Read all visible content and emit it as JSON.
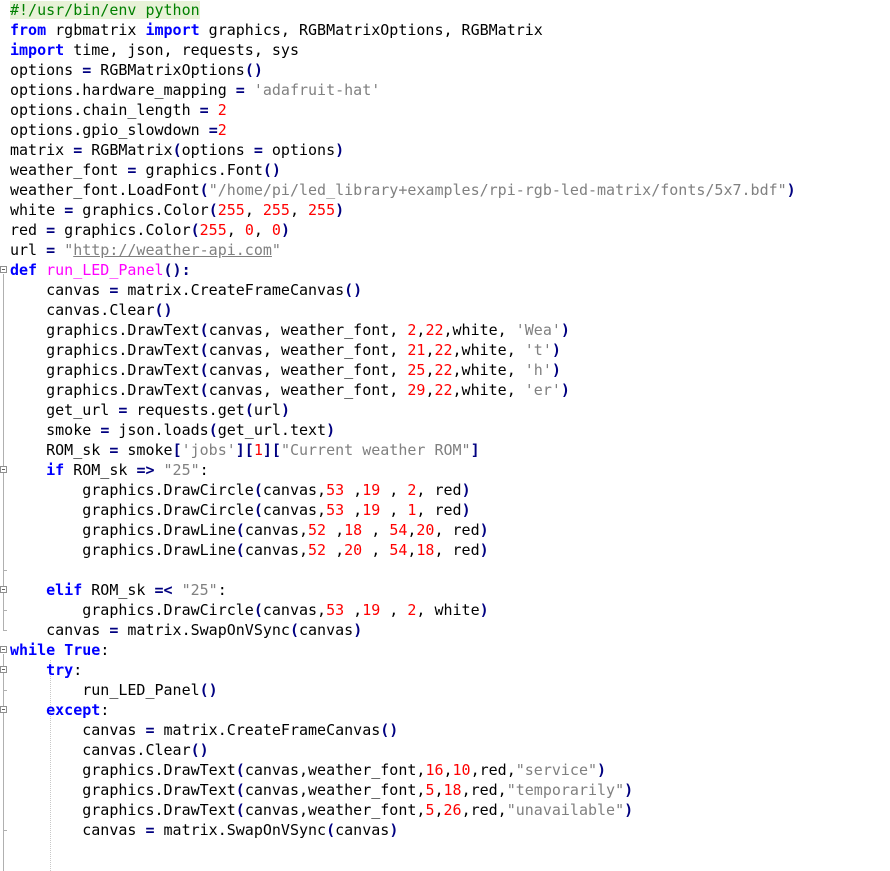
{
  "colors": {
    "default": "#000000",
    "keyword": "#0000ff",
    "string": "#808080",
    "number": "#ff0000",
    "operator": "#000080",
    "comment": "#008000",
    "funcdef": "#ff00ff",
    "url": "#808080"
  },
  "lines": [
    [
      [
        "comment",
        "#!/usr/bin/env python"
      ]
    ],
    [
      [
        "keyword",
        "from"
      ],
      [
        "default",
        " rgbmatrix "
      ],
      [
        "keyword",
        "import"
      ],
      [
        "default",
        " graphics, RGBMatrixOptions, RGBMatrix"
      ]
    ],
    [
      [
        "keyword",
        "import"
      ],
      [
        "default",
        " time, json, requests, sys"
      ]
    ],
    [
      [
        "default",
        "options "
      ],
      [
        "operator",
        "="
      ],
      [
        "default",
        " RGBMatrixOptions"
      ],
      [
        "operator",
        "()"
      ]
    ],
    [
      [
        "default",
        "options.hardware_mapping "
      ],
      [
        "operator",
        "="
      ],
      [
        "default",
        " "
      ],
      [
        "string",
        "'adafruit-hat'"
      ]
    ],
    [
      [
        "default",
        "options.chain_length "
      ],
      [
        "operator",
        "="
      ],
      [
        "default",
        " "
      ],
      [
        "number",
        "2"
      ]
    ],
    [
      [
        "default",
        "options.gpio_slowdown "
      ],
      [
        "operator",
        "="
      ],
      [
        "number",
        "2"
      ]
    ],
    [
      [
        "default",
        "matrix "
      ],
      [
        "operator",
        "="
      ],
      [
        "default",
        " RGBMatrix"
      ],
      [
        "operator",
        "("
      ],
      [
        "default",
        "options "
      ],
      [
        "operator",
        "="
      ],
      [
        "default",
        " options"
      ],
      [
        "operator",
        ")"
      ]
    ],
    [
      [
        "default",
        "weather_font "
      ],
      [
        "operator",
        "="
      ],
      [
        "default",
        " graphics.Font"
      ],
      [
        "operator",
        "()"
      ]
    ],
    [
      [
        "default",
        "weather_font.LoadFont"
      ],
      [
        "operator",
        "("
      ],
      [
        "string",
        "\"/home/pi/led_library+examples/rpi-rgb-led-matrix/fonts/5x7.bdf\""
      ],
      [
        "operator",
        ")"
      ]
    ],
    [
      [
        "default",
        "white "
      ],
      [
        "operator",
        "="
      ],
      [
        "default",
        " graphics.Color"
      ],
      [
        "operator",
        "("
      ],
      [
        "number",
        "255"
      ],
      [
        "default",
        ", "
      ],
      [
        "number",
        "255"
      ],
      [
        "default",
        ", "
      ],
      [
        "number",
        "255"
      ],
      [
        "operator",
        ")"
      ]
    ],
    [
      [
        "default",
        "red "
      ],
      [
        "operator",
        "="
      ],
      [
        "default",
        " graphics.Color"
      ],
      [
        "operator",
        "("
      ],
      [
        "number",
        "255"
      ],
      [
        "default",
        ", "
      ],
      [
        "number",
        "0"
      ],
      [
        "default",
        ", "
      ],
      [
        "number",
        "0"
      ],
      [
        "operator",
        ")"
      ]
    ],
    [
      [
        "default",
        "url "
      ],
      [
        "operator",
        "="
      ],
      [
        "default",
        " "
      ],
      [
        "string",
        "\""
      ],
      [
        "url",
        "http://weather-api.com"
      ],
      [
        "string",
        "\""
      ]
    ],
    [
      [
        "keyword",
        "def"
      ],
      [
        "default",
        " "
      ],
      [
        "funcdef",
        "run_LED_Panel"
      ],
      [
        "operator",
        "():"
      ]
    ],
    [
      [
        "default",
        "    canvas "
      ],
      [
        "operator",
        "="
      ],
      [
        "default",
        " matrix.CreateFrameCanvas"
      ],
      [
        "operator",
        "()"
      ]
    ],
    [
      [
        "default",
        "    canvas.Clear"
      ],
      [
        "operator",
        "()"
      ]
    ],
    [
      [
        "default",
        "    graphics.DrawText"
      ],
      [
        "operator",
        "("
      ],
      [
        "default",
        "canvas, weather_font, "
      ],
      [
        "number",
        "2"
      ],
      [
        "default",
        ","
      ],
      [
        "number",
        "22"
      ],
      [
        "default",
        ",white, "
      ],
      [
        "string",
        "'Wea'"
      ],
      [
        "operator",
        ")"
      ]
    ],
    [
      [
        "default",
        "    graphics.DrawText"
      ],
      [
        "operator",
        "("
      ],
      [
        "default",
        "canvas, weather_font, "
      ],
      [
        "number",
        "21"
      ],
      [
        "default",
        ","
      ],
      [
        "number",
        "22"
      ],
      [
        "default",
        ",white, "
      ],
      [
        "string",
        "'t'"
      ],
      [
        "operator",
        ")"
      ]
    ],
    [
      [
        "default",
        "    graphics.DrawText"
      ],
      [
        "operator",
        "("
      ],
      [
        "default",
        "canvas, weather_font, "
      ],
      [
        "number",
        "25"
      ],
      [
        "default",
        ","
      ],
      [
        "number",
        "22"
      ],
      [
        "default",
        ",white, "
      ],
      [
        "string",
        "'h'"
      ],
      [
        "operator",
        ")"
      ]
    ],
    [
      [
        "default",
        "    graphics.DrawText"
      ],
      [
        "operator",
        "("
      ],
      [
        "default",
        "canvas, weather_font, "
      ],
      [
        "number",
        "29"
      ],
      [
        "default",
        ","
      ],
      [
        "number",
        "22"
      ],
      [
        "default",
        ",white, "
      ],
      [
        "string",
        "'er'"
      ],
      [
        "operator",
        ")"
      ]
    ],
    [
      [
        "default",
        "    get_url "
      ],
      [
        "operator",
        "="
      ],
      [
        "default",
        " requests.get"
      ],
      [
        "operator",
        "("
      ],
      [
        "default",
        "url"
      ],
      [
        "operator",
        ")"
      ]
    ],
    [
      [
        "default",
        "    smoke "
      ],
      [
        "operator",
        "="
      ],
      [
        "default",
        " json.loads"
      ],
      [
        "operator",
        "("
      ],
      [
        "default",
        "get_url.text"
      ],
      [
        "operator",
        ")"
      ]
    ],
    [
      [
        "default",
        "    ROM_sk "
      ],
      [
        "operator",
        "="
      ],
      [
        "default",
        " smoke"
      ],
      [
        "operator",
        "["
      ],
      [
        "string",
        "'jobs'"
      ],
      [
        "operator",
        "]["
      ],
      [
        "number",
        "1"
      ],
      [
        "operator",
        "]["
      ],
      [
        "string",
        "\"Current weather ROM\""
      ],
      [
        "operator",
        "]"
      ]
    ],
    [
      [
        "default",
        "    "
      ],
      [
        "keyword",
        "if"
      ],
      [
        "default",
        " ROM_sk "
      ],
      [
        "operator",
        "=>"
      ],
      [
        "default",
        " "
      ],
      [
        "string",
        "\"25\""
      ],
      [
        "default",
        ":"
      ]
    ],
    [
      [
        "default",
        "        graphics.DrawCircle"
      ],
      [
        "operator",
        "("
      ],
      [
        "default",
        "canvas,"
      ],
      [
        "number",
        "53"
      ],
      [
        "default",
        " ,"
      ],
      [
        "number",
        "19"
      ],
      [
        "default",
        " , "
      ],
      [
        "number",
        "2"
      ],
      [
        "default",
        ", red"
      ],
      [
        "operator",
        ")"
      ]
    ],
    [
      [
        "default",
        "        graphics.DrawCircle"
      ],
      [
        "operator",
        "("
      ],
      [
        "default",
        "canvas,"
      ],
      [
        "number",
        "53"
      ],
      [
        "default",
        " ,"
      ],
      [
        "number",
        "19"
      ],
      [
        "default",
        " , "
      ],
      [
        "number",
        "1"
      ],
      [
        "default",
        ", red"
      ],
      [
        "operator",
        ")"
      ]
    ],
    [
      [
        "default",
        "        graphics.DrawLine"
      ],
      [
        "operator",
        "("
      ],
      [
        "default",
        "canvas,"
      ],
      [
        "number",
        "52"
      ],
      [
        "default",
        " ,"
      ],
      [
        "number",
        "18"
      ],
      [
        "default",
        " , "
      ],
      [
        "number",
        "54"
      ],
      [
        "default",
        ","
      ],
      [
        "number",
        "20"
      ],
      [
        "default",
        ", red"
      ],
      [
        "operator",
        ")"
      ]
    ],
    [
      [
        "default",
        "        graphics.DrawLine"
      ],
      [
        "operator",
        "("
      ],
      [
        "default",
        "canvas,"
      ],
      [
        "number",
        "52"
      ],
      [
        "default",
        " ,"
      ],
      [
        "number",
        "20"
      ],
      [
        "default",
        " , "
      ],
      [
        "number",
        "54"
      ],
      [
        "default",
        ","
      ],
      [
        "number",
        "18"
      ],
      [
        "default",
        ", red"
      ],
      [
        "operator",
        ")"
      ]
    ],
    [
      [
        "default",
        ""
      ]
    ],
    [
      [
        "default",
        "    "
      ],
      [
        "keyword",
        "elif"
      ],
      [
        "default",
        " ROM_sk "
      ],
      [
        "operator",
        "=<"
      ],
      [
        "default",
        " "
      ],
      [
        "string",
        "\"25\""
      ],
      [
        "default",
        ":"
      ]
    ],
    [
      [
        "default",
        "        graphics.DrawCircle"
      ],
      [
        "operator",
        "("
      ],
      [
        "default",
        "canvas,"
      ],
      [
        "number",
        "53"
      ],
      [
        "default",
        " ,"
      ],
      [
        "number",
        "19"
      ],
      [
        "default",
        " , "
      ],
      [
        "number",
        "2"
      ],
      [
        "default",
        ", white"
      ],
      [
        "operator",
        ")"
      ]
    ],
    [
      [
        "default",
        "    canvas "
      ],
      [
        "operator",
        "="
      ],
      [
        "default",
        " matrix.SwapOnVSync"
      ],
      [
        "operator",
        "("
      ],
      [
        "default",
        "canvas"
      ],
      [
        "operator",
        ")"
      ]
    ],
    [
      [
        "keyword",
        "while"
      ],
      [
        "default",
        " "
      ],
      [
        "keyword",
        "True"
      ],
      [
        "default",
        ":"
      ]
    ],
    [
      [
        "default",
        "    "
      ],
      [
        "keyword",
        "try"
      ],
      [
        "default",
        ":"
      ]
    ],
    [
      [
        "default",
        "        run_LED_Panel"
      ],
      [
        "operator",
        "()"
      ]
    ],
    [
      [
        "default",
        "    "
      ],
      [
        "keyword",
        "except"
      ],
      [
        "default",
        ":"
      ]
    ],
    [
      [
        "default",
        "        canvas "
      ],
      [
        "operator",
        "="
      ],
      [
        "default",
        " matrix.CreateFrameCanvas"
      ],
      [
        "operator",
        "()"
      ]
    ],
    [
      [
        "default",
        "        canvas.Clear"
      ],
      [
        "operator",
        "()"
      ]
    ],
    [
      [
        "default",
        "        graphics.DrawText"
      ],
      [
        "operator",
        "("
      ],
      [
        "default",
        "canvas,weather_font,"
      ],
      [
        "number",
        "16"
      ],
      [
        "default",
        ","
      ],
      [
        "number",
        "10"
      ],
      [
        "default",
        ",red,"
      ],
      [
        "string",
        "\"service\""
      ],
      [
        "operator",
        ")"
      ]
    ],
    [
      [
        "default",
        "        graphics.DrawText"
      ],
      [
        "operator",
        "("
      ],
      [
        "default",
        "canvas,weather_font,"
      ],
      [
        "number",
        "5"
      ],
      [
        "default",
        ","
      ],
      [
        "number",
        "18"
      ],
      [
        "default",
        ",red,"
      ],
      [
        "string",
        "\"temporarily\""
      ],
      [
        "operator",
        ")"
      ]
    ],
    [
      [
        "default",
        "        graphics.DrawText"
      ],
      [
        "operator",
        "("
      ],
      [
        "default",
        "canvas,weather_font,"
      ],
      [
        "number",
        "5"
      ],
      [
        "default",
        ","
      ],
      [
        "number",
        "26"
      ],
      [
        "default",
        ",red,"
      ],
      [
        "string",
        "\"unavailable\""
      ],
      [
        "operator",
        ")"
      ]
    ],
    [
      [
        "default",
        "        canvas "
      ],
      [
        "operator",
        "="
      ],
      [
        "default",
        " matrix.SwapOnVSync"
      ],
      [
        "operator",
        "("
      ],
      [
        "default",
        "canvas"
      ],
      [
        "operator",
        ")"
      ]
    ]
  ]
}
